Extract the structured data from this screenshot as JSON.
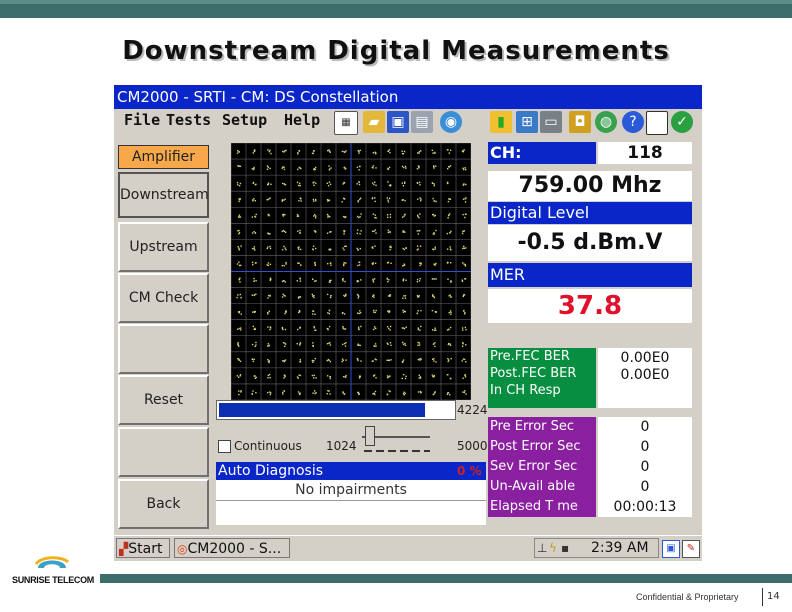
{
  "slide": {
    "title": "Downstream Digital Measurements",
    "logo_text": "SUNRISE TELECOM",
    "confidential": "Confidential & Proprietary",
    "page_number": "14"
  },
  "window": {
    "title": "CM2000 - SRTI - CM: DS Constellation",
    "menu": [
      "File",
      "Tests",
      "Setup",
      "Help"
    ],
    "toolbar_icons": [
      "keypad-icon",
      "folder-open-icon",
      "save-icon",
      "print-icon",
      "globe-icon",
      "bar-chart-icon",
      "network-icon",
      "modem-icon",
      "lock-icon",
      "palette-icon",
      "help-icon",
      "blank-box-icon",
      "check-icon"
    ]
  },
  "side_buttons": {
    "amplifier": "Amplifier",
    "downstream": "Downstream",
    "upstream": "Upstream",
    "cm_check": "CM Check",
    "blank": "",
    "reset": "Reset",
    "blank2": "",
    "back": "Back"
  },
  "constellation": {
    "progress_fraction": 0.88,
    "count_label": "4224",
    "continuous_label": "Continuous",
    "slider_min": "1024",
    "slider_max": "5000",
    "slider_fraction": 0.05
  },
  "diagnosis": {
    "header": "Auto Diagnosis",
    "percent": "0 %",
    "message": "No impairments"
  },
  "readings": {
    "ch_label": "CH:",
    "ch_value": "118",
    "frequency": "759.00 Mhz",
    "digital_level_label": "Digital Level",
    "digital_level_value": "-0.5 d.Bm.V",
    "mer_label": "MER",
    "mer_value": "37.8",
    "ber": [
      {
        "label": "Pre.FEC BER",
        "value": "0.00E0"
      },
      {
        "label": "Post.FEC BER",
        "value": "0.00E0"
      },
      {
        "label": "In CH Resp",
        "value": ""
      }
    ],
    "errors": [
      {
        "label": "Pre Error Sec",
        "value": "0"
      },
      {
        "label": "Post Error Sec",
        "value": "0"
      },
      {
        "label": "Sev Error Sec",
        "value": "0"
      },
      {
        "label": "Un-Avail able",
        "value": "0"
      },
      {
        "label": "Elapsed T me",
        "value": "00:00:13"
      }
    ]
  },
  "taskbar": {
    "start_label": "Start",
    "task_label": "CM2000 - S...",
    "clock": "2:39 AM"
  },
  "colors": {
    "slide_band": "#3e6e6b",
    "title_bar": "#0a26c8",
    "amplifier_button": "#f7a84a",
    "ber_green": "#088e40",
    "error_purple": "#8a1fa0",
    "mer_red": "#e0102a",
    "constellation_point": "#d8d26a"
  }
}
